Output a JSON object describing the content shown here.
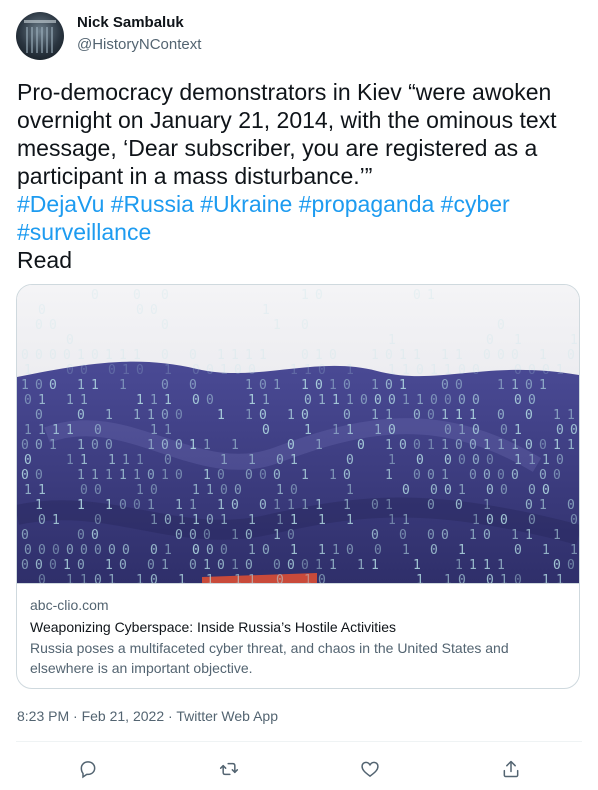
{
  "author": {
    "name": "Nick Sambaluk",
    "handle": "@HistoryNContext"
  },
  "tweet": {
    "text": "Pro-democracy demonstrators in Kiev “were awoken overnight on January 21, 2014, with the ominous text message, ‘Dear subscriber, you are registered as a participant in a mass disturbance.’”",
    "hashtags": [
      "#DejaVu",
      "#Russia",
      "#Ukraine",
      "#propaganda",
      "#cyber",
      "#surveillance"
    ],
    "trailing": "Read"
  },
  "card": {
    "domain": "abc-clio.com",
    "title": "Weaponizing Cyberspace: Inside Russia’s Hostile Activities",
    "description": "Russia poses a multifaceted cyber threat, and chaos in the United States and elsewhere is an important objective."
  },
  "meta": {
    "time": "8:23 PM",
    "sep": " · ",
    "date": "Feb 21, 2022",
    "source": "Twitter Web App"
  },
  "actions": [
    {
      "name": "reply",
      "icon": "reply-icon"
    },
    {
      "name": "retweet",
      "icon": "retweet-icon"
    },
    {
      "name": "like",
      "icon": "like-icon"
    },
    {
      "name": "share",
      "icon": "share-icon"
    }
  ],
  "colors": {
    "link": "#1d9bf0",
    "text": "#0f1419",
    "muted": "#536471",
    "border": "#cfd9de",
    "flag_blue": "#3f3f8a"
  }
}
